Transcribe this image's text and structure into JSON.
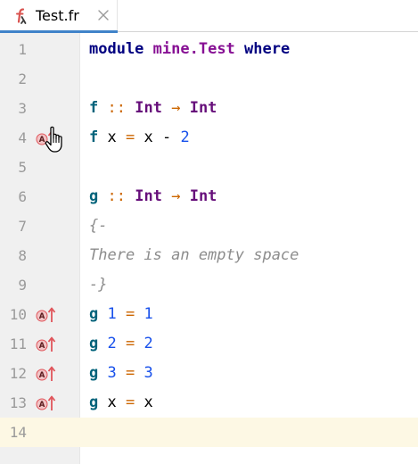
{
  "tab": {
    "title": "Test.fr",
    "icon": "frege-file-icon",
    "close_icon": "close-icon"
  },
  "colors": {
    "keyword": "#000080",
    "module_name": "#871094",
    "type": "#660e7a",
    "function": "#00627a",
    "operator": "#cc6600",
    "number": "#1750eb",
    "comment": "#8c8c8c",
    "current_line": "#fdf8e4",
    "gutter_marker": "#e0555b"
  },
  "editor": {
    "current_line": 14,
    "lines": [
      {
        "n": "1",
        "marker": false,
        "tokens": [
          {
            "t": "module",
            "c": "kw"
          },
          {
            "t": " ",
            "c": "var"
          },
          {
            "t": "mine.Test",
            "c": "mod"
          },
          {
            "t": " ",
            "c": "var"
          },
          {
            "t": "where",
            "c": "kw"
          }
        ]
      },
      {
        "n": "2",
        "marker": false,
        "tokens": []
      },
      {
        "n": "3",
        "marker": false,
        "tokens": [
          {
            "t": "f",
            "c": "fn"
          },
          {
            "t": " ",
            "c": "var"
          },
          {
            "t": "::",
            "c": "op"
          },
          {
            "t": " ",
            "c": "var"
          },
          {
            "t": "Int",
            "c": "type"
          },
          {
            "t": " ",
            "c": "var"
          },
          {
            "t": "→",
            "c": "arrow"
          },
          {
            "t": " ",
            "c": "var"
          },
          {
            "t": "Int",
            "c": "type"
          }
        ]
      },
      {
        "n": "4",
        "marker": true,
        "tokens": [
          {
            "t": "f",
            "c": "fn"
          },
          {
            "t": " ",
            "c": "var"
          },
          {
            "t": "x",
            "c": "var"
          },
          {
            "t": " ",
            "c": "var"
          },
          {
            "t": "=",
            "c": "op"
          },
          {
            "t": " ",
            "c": "var"
          },
          {
            "t": "x",
            "c": "var"
          },
          {
            "t": " ",
            "c": "var"
          },
          {
            "t": "-",
            "c": "var"
          },
          {
            "t": " ",
            "c": "var"
          },
          {
            "t": "2",
            "c": "num"
          }
        ]
      },
      {
        "n": "5",
        "marker": false,
        "tokens": []
      },
      {
        "n": "6",
        "marker": false,
        "tokens": [
          {
            "t": "g",
            "c": "fn"
          },
          {
            "t": " ",
            "c": "var"
          },
          {
            "t": "::",
            "c": "op"
          },
          {
            "t": " ",
            "c": "var"
          },
          {
            "t": "Int",
            "c": "type"
          },
          {
            "t": " ",
            "c": "var"
          },
          {
            "t": "→",
            "c": "arrow"
          },
          {
            "t": " ",
            "c": "var"
          },
          {
            "t": "Int",
            "c": "type"
          }
        ]
      },
      {
        "n": "7",
        "marker": false,
        "tokens": [
          {
            "t": "{-",
            "c": "cmt"
          }
        ]
      },
      {
        "n": "8",
        "marker": false,
        "tokens": [
          {
            "t": "There is an empty space",
            "c": "cmt"
          }
        ]
      },
      {
        "n": "9",
        "marker": false,
        "tokens": [
          {
            "t": "-}",
            "c": "cmt"
          }
        ]
      },
      {
        "n": "10",
        "marker": true,
        "tokens": [
          {
            "t": "g",
            "c": "fn"
          },
          {
            "t": " ",
            "c": "var"
          },
          {
            "t": "1",
            "c": "num"
          },
          {
            "t": " ",
            "c": "var"
          },
          {
            "t": "=",
            "c": "op"
          },
          {
            "t": " ",
            "c": "var"
          },
          {
            "t": "1",
            "c": "num"
          }
        ]
      },
      {
        "n": "11",
        "marker": true,
        "tokens": [
          {
            "t": "g",
            "c": "fn"
          },
          {
            "t": " ",
            "c": "var"
          },
          {
            "t": "2",
            "c": "num"
          },
          {
            "t": " ",
            "c": "var"
          },
          {
            "t": "=",
            "c": "op"
          },
          {
            "t": " ",
            "c": "var"
          },
          {
            "t": "2",
            "c": "num"
          }
        ]
      },
      {
        "n": "12",
        "marker": true,
        "tokens": [
          {
            "t": "g",
            "c": "fn"
          },
          {
            "t": " ",
            "c": "var"
          },
          {
            "t": "3",
            "c": "num"
          },
          {
            "t": " ",
            "c": "var"
          },
          {
            "t": "=",
            "c": "op"
          },
          {
            "t": " ",
            "c": "var"
          },
          {
            "t": "3",
            "c": "num"
          }
        ]
      },
      {
        "n": "13",
        "marker": true,
        "tokens": [
          {
            "t": "g",
            "c": "fn"
          },
          {
            "t": " ",
            "c": "var"
          },
          {
            "t": "x",
            "c": "var"
          },
          {
            "t": " ",
            "c": "var"
          },
          {
            "t": "=",
            "c": "op"
          },
          {
            "t": " ",
            "c": "var"
          },
          {
            "t": "x",
            "c": "var"
          }
        ]
      },
      {
        "n": "14",
        "marker": false,
        "tokens": []
      }
    ]
  },
  "cursor": {
    "icon": "hand-pointer-icon"
  }
}
